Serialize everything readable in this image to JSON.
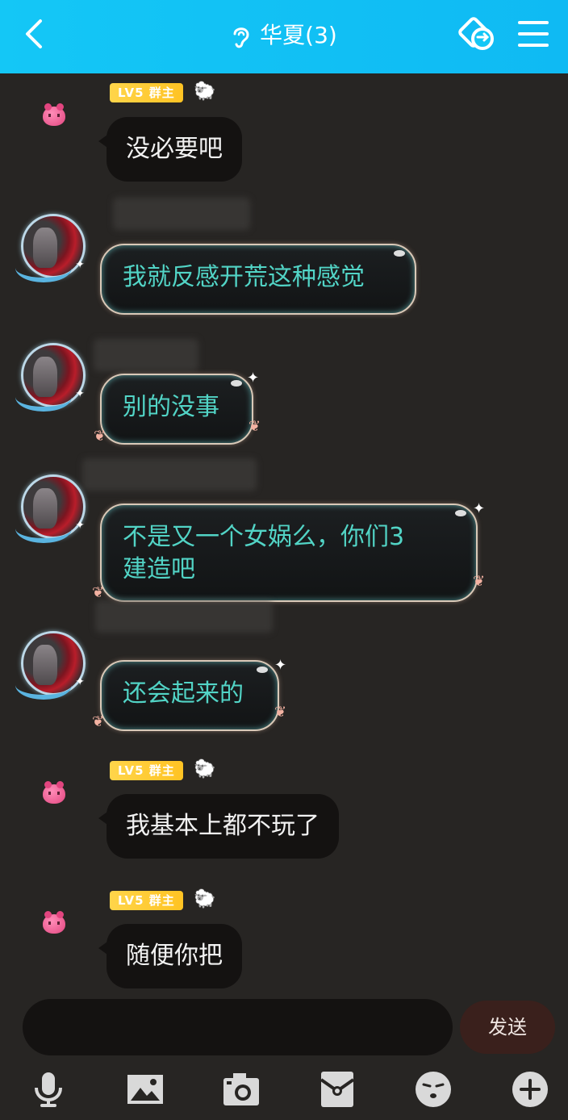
{
  "header": {
    "title": "华夏(3)",
    "bg_color": "#14c7f6"
  },
  "messages": [
    {
      "side": "left",
      "sender": "group-owner",
      "badge": "LV5 群主",
      "avatar": "pink-pet-avatar",
      "text": "没必要吧"
    },
    {
      "side": "left",
      "sender": "member",
      "avatar": "anime-girl-avatar",
      "text": "我就反感开荒这种感觉"
    },
    {
      "side": "left",
      "sender": "member",
      "avatar": "anime-girl-avatar",
      "text": "别的没事"
    },
    {
      "side": "left",
      "sender": "member",
      "avatar": "anime-girl-avatar",
      "text_lines": [
        "不是又一个女娲么，你们3",
        "建造吧"
      ]
    },
    {
      "side": "left",
      "sender": "member",
      "avatar": "anime-girl-avatar",
      "text": "还会起来的"
    },
    {
      "side": "left",
      "sender": "group-owner",
      "badge": "LV5 群主",
      "avatar": "pink-pet-avatar",
      "text": "我基本上都不玩了"
    },
    {
      "side": "left",
      "sender": "group-owner",
      "badge": "LV5 群主",
      "avatar": "pink-pet-avatar",
      "text": "随便你把"
    }
  ],
  "composer": {
    "input_value": "",
    "send_label": "发送"
  },
  "toolbar": [
    "microphone-icon",
    "image-icon",
    "camera-icon",
    "red-packet-icon",
    "emoji-icon",
    "plus-icon"
  ],
  "colors": {
    "background": "#272523",
    "bubble_dark": "#141211",
    "bubble_deco_text": "#52d4c6",
    "badge": "#ffc323"
  }
}
